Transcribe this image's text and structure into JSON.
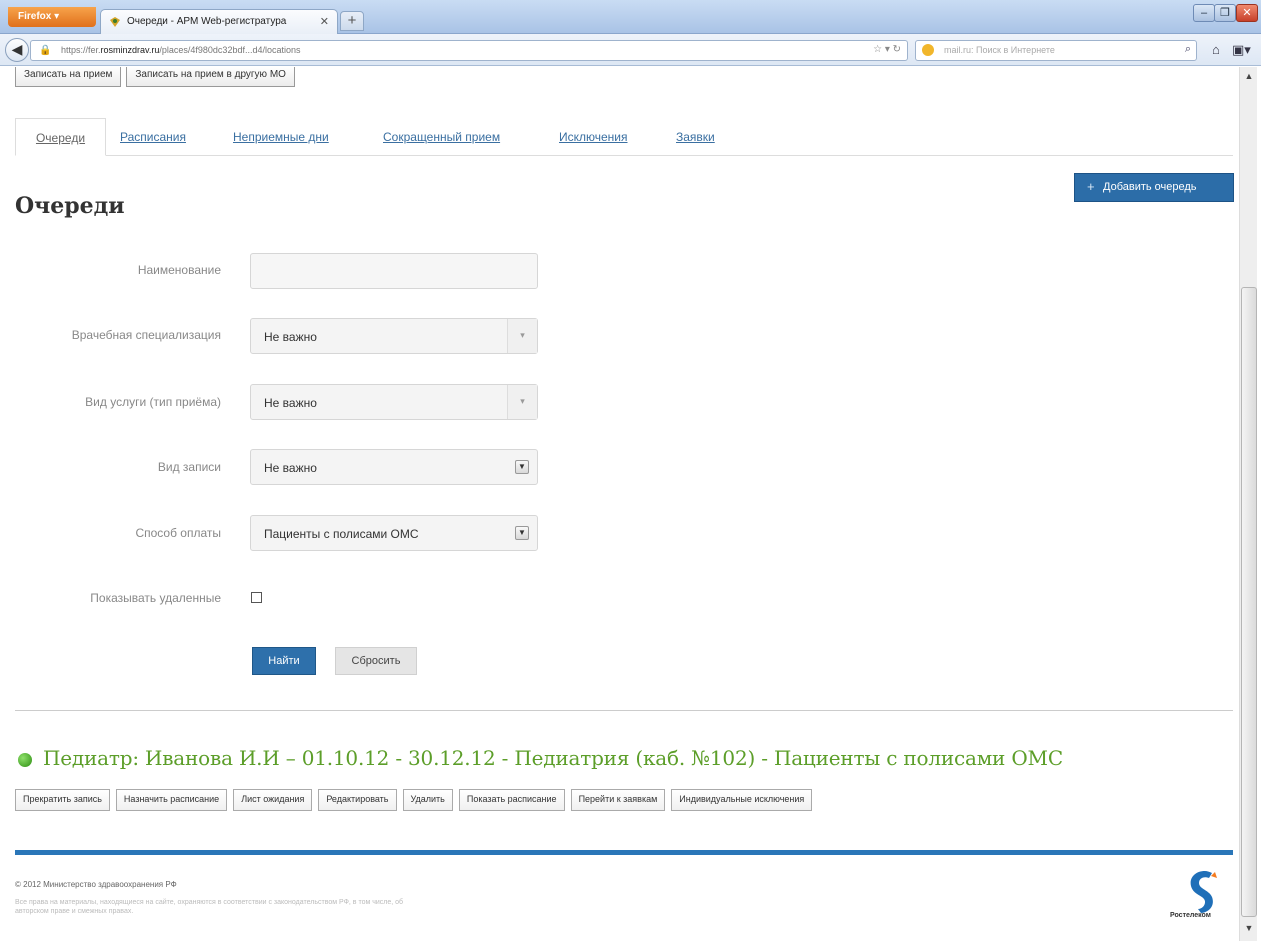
{
  "browser": {
    "menu_button": "Firefox",
    "tab_title": "Очереди - АРМ Web-регистратура",
    "new_tab": "+",
    "url_prefix": "https://fer.",
    "url_domain": "rosminzdrav.ru",
    "url_path": "/places/4f980dc32bdf...d4/locations",
    "search_placeholder": "mail.ru: Поиск в Интернете"
  },
  "top_buttons": {
    "book": "Записать на прием",
    "book_other": "Записать на прием в другую МО"
  },
  "tabs": [
    "Очереди",
    "Расписания",
    "Неприемные дни",
    "Сокращенный прием",
    "Исключения",
    "Заявки"
  ],
  "add_queue_label": "Добавить очередь",
  "page_title": "Очереди",
  "form": {
    "name_label": "Наименование",
    "name_value": "",
    "spec_label": "Врачебная специализация",
    "spec_value": "Не важно",
    "service_label": "Вид услуги (тип приёма)",
    "service_value": "Не важно",
    "record_label": "Вид записи",
    "record_value": "Не важно",
    "payment_label": "Способ оплаты",
    "payment_value": "Пациенты с полисами ОМС",
    "show_deleted_label": "Показывать удаленные",
    "show_deleted_checked": false,
    "find_button": "Найти",
    "reset_button": "Сбросить"
  },
  "queue": {
    "status_color": "#3c9d1c",
    "title": "Педиатр: Иванова И.И – 01.10.12 - 30.12.12 - Педиатрия (каб. №102) - Пациенты с полисами ОМС",
    "actions": [
      "Прекратить запись",
      "Назначить расписание",
      "Лист ожидания",
      "Редактировать",
      "Удалить",
      "Показать расписание",
      "Перейти к заявкам",
      "Индивидуальные исключения"
    ]
  },
  "footer": {
    "copyright": "© 2012 Министерство здравоохранения РФ",
    "note": "Все права на материалы, находящиеся на сайте, охраняются в соответствии с законодательством РФ, в том числе, об авторском праве и смежных правах.",
    "logo_text": "Ростелеком"
  },
  "colors": {
    "primary_button": "#2e70ab",
    "tab_link": "#3a6fa1",
    "queue_title": "#5c9e29",
    "footer_bar": "#2a76b8"
  }
}
